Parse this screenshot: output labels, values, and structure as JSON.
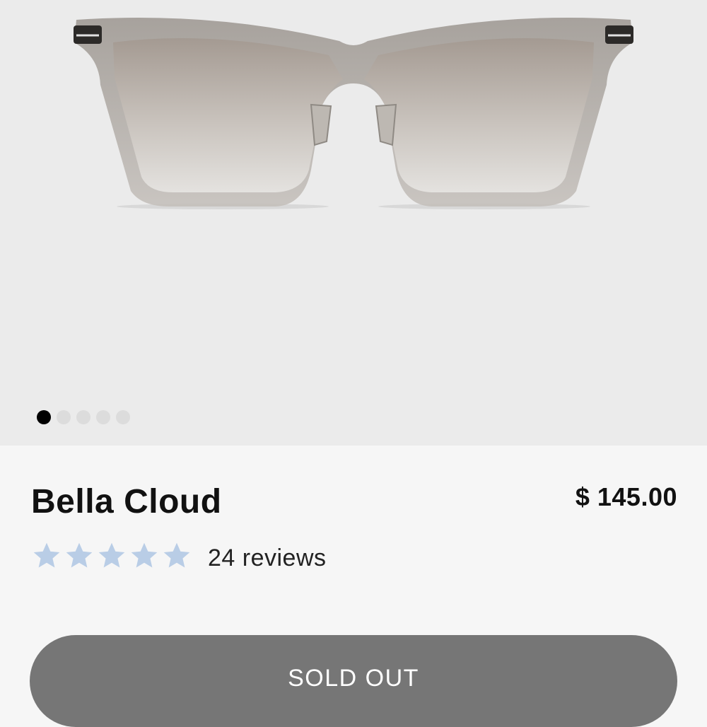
{
  "product": {
    "name": "Bella Cloud",
    "price": "$ 145.00",
    "rating": 5,
    "rating_max": 5,
    "reviews_label": "24 reviews",
    "star_color": "#b9cde6"
  },
  "gallery": {
    "image_count": 5,
    "active_index": 0
  },
  "cta": {
    "label": "SOLD OUT",
    "color": "#767676"
  }
}
